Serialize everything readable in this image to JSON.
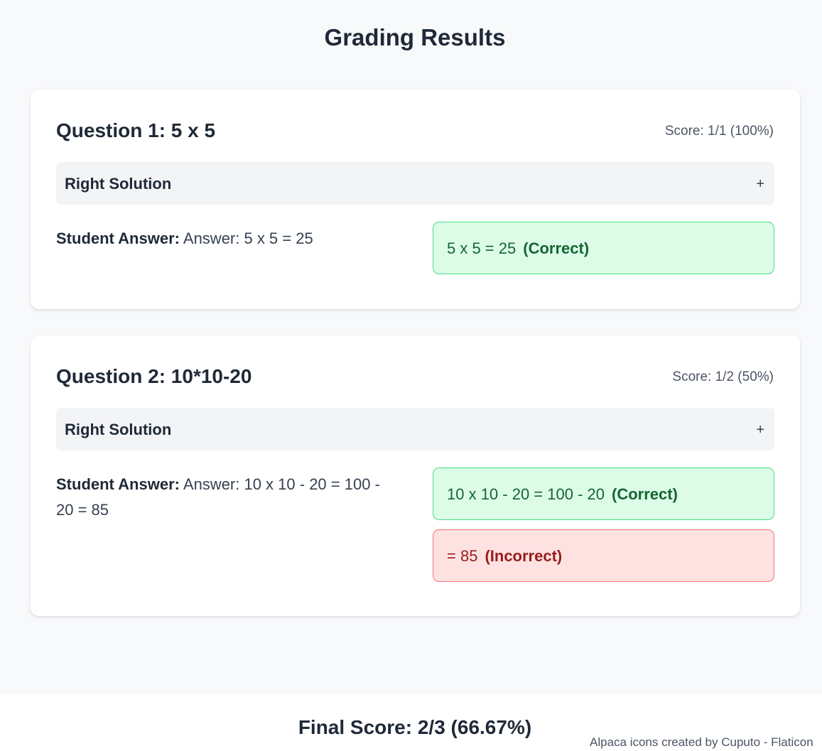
{
  "page": {
    "title": "Grading Results"
  },
  "questions": [
    {
      "title": "Question 1: 5 x 5",
      "score": "Score: 1/1 (100%)",
      "solution_label": "Right Solution",
      "solution_toggle": "+",
      "student_answer_label": "Student Answer:",
      "student_answer": "Answer: 5 x 5 = 25",
      "steps": [
        {
          "text": "5 x 5 = 25",
          "status": "(Correct)",
          "correct": true
        }
      ]
    },
    {
      "title": "Question 2: 10*10-20",
      "score": "Score: 1/2 (50%)",
      "solution_label": "Right Solution",
      "solution_toggle": "+",
      "student_answer_label": "Student Answer:",
      "student_answer": "Answer: 10 x 10 - 20 = 100 - 20 = 85",
      "steps": [
        {
          "text": "10 x 10 - 20 = 100 - 20",
          "status": "(Correct)",
          "correct": true
        },
        {
          "text": "= 85",
          "status": "(Incorrect)",
          "correct": false
        }
      ]
    }
  ],
  "footer": {
    "final_score": "Final Score: 2/3 (66.67%)",
    "credit": "Alpaca icons created by Cuputo - Flaticon"
  },
  "colors": {
    "correct_bg": "#dcfce7",
    "correct_border": "#4ade80",
    "correct_text": "#166534",
    "incorrect_bg": "#fee2e2",
    "incorrect_border": "#f87171",
    "incorrect_text": "#991b1b"
  }
}
